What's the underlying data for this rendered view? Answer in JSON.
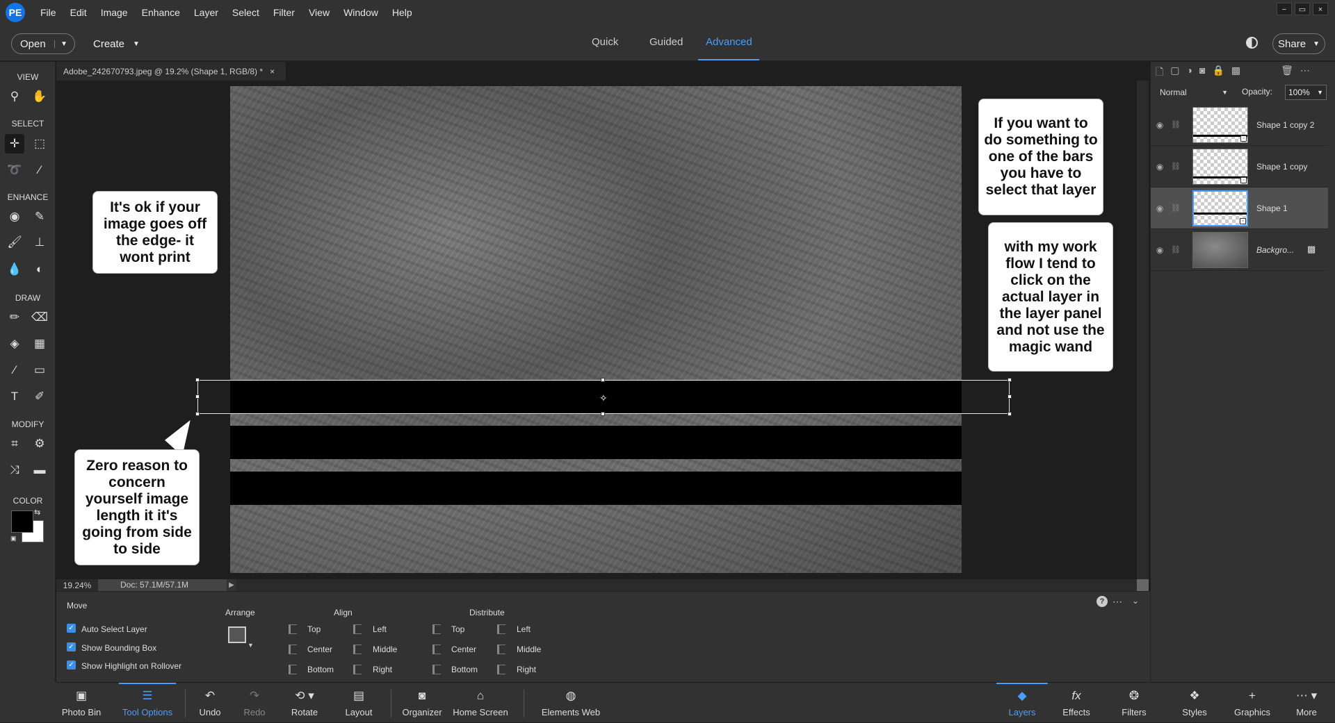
{
  "menubar": {
    "logo": "PE",
    "items": [
      "File",
      "Edit",
      "Image",
      "Enhance",
      "Layer",
      "Select",
      "Filter",
      "View",
      "Window",
      "Help"
    ],
    "window_controls": [
      "−",
      "▭",
      "×"
    ]
  },
  "topbar": {
    "open_label": "Open",
    "create_label": "Create",
    "modes": [
      "Quick",
      "Guided",
      "Advanced"
    ],
    "active_mode": "Advanced",
    "share_label": "Share"
  },
  "toolbox": {
    "sections": [
      "VIEW",
      "SELECT",
      "ENHANCE",
      "DRAW",
      "MODIFY",
      "COLOR"
    ],
    "colors": {
      "foreground": "#000000",
      "background": "#ffffff"
    }
  },
  "document": {
    "tab_title": "Adobe_242670793.jpeg @ 19.2% (Shape 1, RGB/8) *",
    "tab_close": "×",
    "zoom": "19.24%",
    "doc_size": "Doc: 57.1M/57.1M"
  },
  "callouts": {
    "left_top": "It's ok if your image goes off the edge- it wont print",
    "left_bottom": "Zero reason to concern yourself image length it it's going from side to side",
    "right_top": "If you want to do something to one of the bars you have to select that layer",
    "right_bottom": "with my work flow I tend to click on the actual layer in the layer panel and not use the magic wand"
  },
  "layers_panel": {
    "blend_mode": "Normal",
    "opacity_label": "Opacity:",
    "opacity_value": "100%",
    "layers": [
      {
        "name": "Shape 1 copy 2",
        "selected": false
      },
      {
        "name": "Shape 1 copy",
        "selected": false
      },
      {
        "name": "Shape 1",
        "selected": true
      },
      {
        "name": "Backgro...",
        "selected": false
      }
    ]
  },
  "tool_options": {
    "tool_name": "Move",
    "checkboxes": [
      "Auto Select Layer",
      "Show Bounding Box",
      "Show Highlight on Rollover"
    ],
    "arrange_label": "Arrange",
    "align_label": "Align",
    "align_items": [
      "Top",
      "Center",
      "Bottom",
      "Left",
      "Middle",
      "Right"
    ],
    "distribute_label": "Distribute",
    "distribute_items": [
      "Top",
      "Center",
      "Bottom",
      "Left",
      "Middle",
      "Right"
    ]
  },
  "taskbar": {
    "left": [
      "Photo Bin",
      "Tool Options",
      "Undo",
      "Redo",
      "Rotate",
      "Layout",
      "Organizer",
      "Home Screen",
      "Elements Web"
    ],
    "right": [
      "Layers",
      "Effects",
      "Filters",
      "Styles",
      "Graphics",
      "More"
    ],
    "active_left": "Tool Options",
    "active_right": "Layers"
  }
}
